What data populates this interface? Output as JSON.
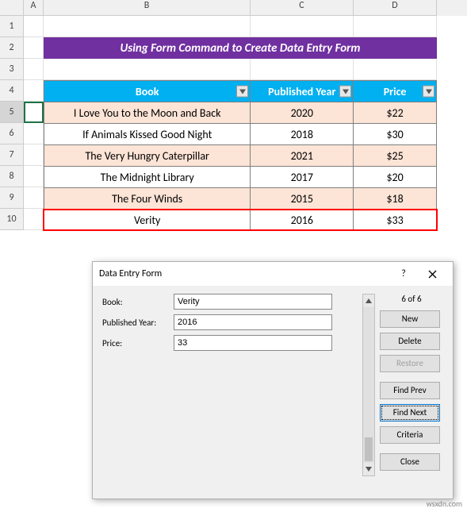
{
  "columns": [
    "A",
    "B",
    "C",
    "D"
  ],
  "rows": [
    "1",
    "2",
    "3",
    "4",
    "5",
    "6",
    "7",
    "8",
    "9",
    "10"
  ],
  "title": "Using Form Command to Create Data Entry Form",
  "headers": {
    "book": "Book",
    "year": "Published Year",
    "price": "Price"
  },
  "data": [
    {
      "book": "I Love You to the Moon and Back",
      "year": "2020",
      "price": "$22"
    },
    {
      "book": "If Animals Kissed Good Night",
      "year": "2018",
      "price": "$30"
    },
    {
      "book": "The Very Hungry Caterpillar",
      "year": "2021",
      "price": "$25"
    },
    {
      "book": "The Midnight Library",
      "year": "2017",
      "price": "$20"
    },
    {
      "book": "The Four Winds",
      "year": "2015",
      "price": "$18"
    },
    {
      "book": "Verity",
      "year": "2016",
      "price": "$33"
    }
  ],
  "dialog": {
    "title": "Data Entry Form",
    "labels": {
      "book": "Book:",
      "year": "Published Year:",
      "price": "Price:"
    },
    "values": {
      "book": "Verity",
      "year": "2016",
      "price": "33"
    },
    "count": "6 of 6",
    "buttons": {
      "new": "New",
      "delete": "Delete",
      "restore": "Restore",
      "findprev": "Find Prev",
      "findnext": "Find Next",
      "criteria": "Criteria",
      "close": "Close"
    }
  },
  "watermark": "wsxdn.com",
  "chart_data": {
    "type": "table",
    "columns": [
      "Book",
      "Published Year",
      "Price"
    ],
    "rows": [
      [
        "I Love You to the Moon and Back",
        2020,
        22
      ],
      [
        "If Animals Kissed Good Night",
        2018,
        30
      ],
      [
        "The Very Hungry Caterpillar",
        2021,
        25
      ],
      [
        "The Midnight Library",
        2017,
        20
      ],
      [
        "The Four Winds",
        2015,
        18
      ],
      [
        "Verity",
        2016,
        33
      ]
    ],
    "title": "Using Form Command to Create Data Entry Form"
  }
}
